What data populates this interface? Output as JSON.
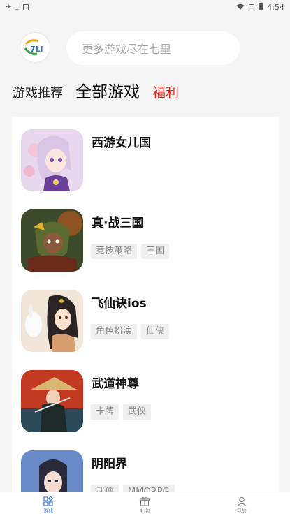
{
  "status_bar": {
    "left_icons": [
      "carrier-icon",
      "download-icon",
      "app-icon"
    ],
    "time": "4:54"
  },
  "header": {
    "logo_text": "7Li",
    "search_placeholder": "更多游戏尽在七里"
  },
  "tabs": [
    {
      "label": "游戏推荐"
    },
    {
      "label": "全部游戏"
    },
    {
      "label": "福利"
    }
  ],
  "games": [
    {
      "name": "西游女儿国",
      "tags": [],
      "icon": "anime-girl-icon"
    },
    {
      "name": "真·战三国",
      "tags": [
        "竞技策略",
        "三国"
      ],
      "icon": "warrior-icon"
    },
    {
      "name": "飞仙诀ios",
      "tags": [
        "角色扮演",
        "仙侠"
      ],
      "icon": "fairy-icon"
    },
    {
      "name": "武道神尊",
      "tags": [
        "卡牌",
        "武侠"
      ],
      "icon": "swordsman-icon"
    },
    {
      "name": "阴阳界",
      "tags": [
        "武侠",
        "MMORPG"
      ],
      "icon": "hero-icon"
    }
  ],
  "bottom_nav": [
    {
      "label": "游戏",
      "icon": "games-grid-icon",
      "active": true
    },
    {
      "label": "礼包",
      "icon": "gift-icon",
      "active": false
    },
    {
      "label": "我的",
      "icon": "user-icon",
      "active": false
    }
  ],
  "colors": {
    "accent": "#3a7de0",
    "welfare": "#e0281c",
    "background": "#f5f5f5"
  }
}
